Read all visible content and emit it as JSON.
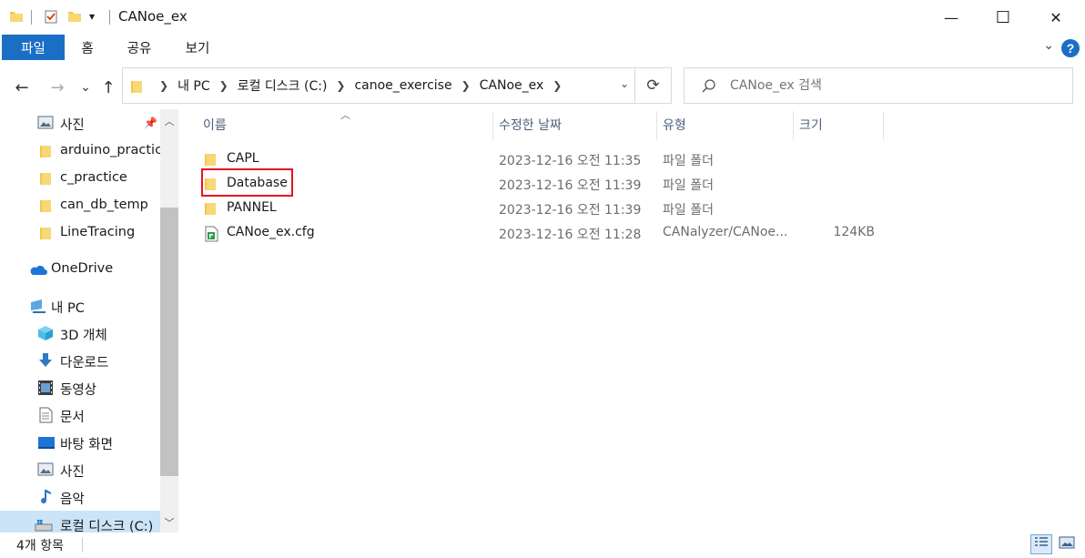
{
  "window": {
    "title": "CANoe_ex",
    "minimize_glyph": "—",
    "maximize_glyph": "☐",
    "close_glyph": "✕"
  },
  "quick_access": {
    "dropdown_glyph": "▾"
  },
  "ribbon": {
    "tabs": [
      "파일",
      "홈",
      "공유",
      "보기"
    ],
    "help_label": "?"
  },
  "navigation": {
    "back_glyph": "←",
    "forward_glyph": "→",
    "recent_glyph": "⌄",
    "up_glyph": "↑",
    "breadcrumbs": [
      "내 PC",
      "로컬 디스크 (C:)",
      "canoe_exercise",
      "CANoe_ex"
    ],
    "refresh_glyph": "⟳",
    "search_placeholder": "CANoe_ex 검색"
  },
  "sidebar": {
    "items": [
      {
        "label": "사진",
        "icon": "pictures-icon",
        "pinned": true
      },
      {
        "label": "arduino_practice",
        "icon": "folder-icon"
      },
      {
        "label": "c_practice",
        "icon": "folder-icon"
      },
      {
        "label": "can_db_temp",
        "icon": "folder-icon"
      },
      {
        "label": "LineTracing",
        "icon": "folder-icon"
      },
      {
        "label": "OneDrive",
        "icon": "onedrive-icon"
      },
      {
        "label": "내 PC",
        "icon": "pc-icon"
      },
      {
        "label": "3D 개체",
        "icon": "3d-objects-icon"
      },
      {
        "label": "다운로드",
        "icon": "downloads-icon"
      },
      {
        "label": "동영상",
        "icon": "videos-icon"
      },
      {
        "label": "문서",
        "icon": "documents-icon"
      },
      {
        "label": "바탕 화면",
        "icon": "desktop-icon"
      },
      {
        "label": "사진",
        "icon": "pictures-icon"
      },
      {
        "label": "음악",
        "icon": "music-icon"
      },
      {
        "label": "로컬 디스크 (C:)",
        "icon": "local-disk-icon",
        "selected": true
      }
    ]
  },
  "file_list": {
    "columns": [
      "이름",
      "수정한 날짜",
      "유형",
      "크기"
    ],
    "rows": [
      {
        "name": "CAPL",
        "date": "2023-12-16 오전 11:35",
        "type": "파일 폴더",
        "size": "",
        "icon": "folder-icon"
      },
      {
        "name": "Database",
        "date": "2023-12-16 오전 11:39",
        "type": "파일 폴더",
        "size": "",
        "icon": "folder-icon",
        "highlighted": true
      },
      {
        "name": "PANNEL",
        "date": "2023-12-16 오전 11:39",
        "type": "파일 폴더",
        "size": "",
        "icon": "folder-icon"
      },
      {
        "name": "CANoe_ex.cfg",
        "date": "2023-12-16 오전 11:28",
        "type": "CANalyzer/CANoe...",
        "size": "124KB",
        "icon": "cfg-file-icon"
      }
    ]
  },
  "status": {
    "item_count": "4개 항목"
  },
  "colors": {
    "accent": "#1a6fc4",
    "folder": "#f3c74c",
    "highlight": "#e81123",
    "selection": "#cce4f7"
  }
}
